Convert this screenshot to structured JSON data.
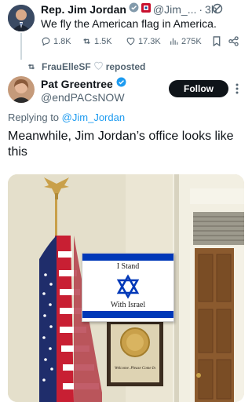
{
  "tweet1": {
    "name": "Rep. Jim Jordan",
    "handle": "@Jim_...",
    "dot": "·",
    "time": "3h",
    "text": "We fly the American flag in America.",
    "actions": {
      "replies": "1.8K",
      "retweets": "1.5K",
      "likes": "17.3K",
      "views": "275K"
    }
  },
  "repost": {
    "user": "FrauElleSF",
    "label": "reposted"
  },
  "tweet2": {
    "name": "Pat Greentree",
    "handle": "@endPACsNOW",
    "follow_label": "Follow",
    "replying_prefix": "Replying to",
    "replying_to": "@Jim_Jordan",
    "text": "Meanwhile, Jim Jordan’s office looks like this",
    "image": {
      "sign_top": "I Stand",
      "sign_bottom": "With Israel",
      "plaque_text": "Welcome. Please Come In"
    }
  },
  "colors": {
    "accent": "#1d9bf0",
    "muted": "#536471",
    "text": "#0f1419",
    "israel_blue": "#0038b8"
  },
  "icons": [
    "verified-badge-icon",
    "flag-badge-icon",
    "mute-icon",
    "reply-icon",
    "retweet-icon",
    "like-icon",
    "views-icon",
    "bookmark-icon",
    "share-icon",
    "more-icon"
  ]
}
